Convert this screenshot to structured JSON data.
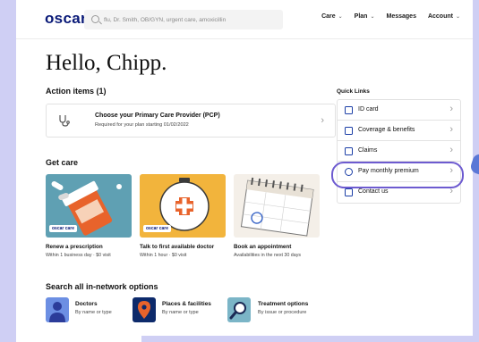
{
  "header": {
    "logo": "oscar",
    "search_placeholder": "flu, Dr. Smith, OB/GYN, urgent care, amoxicillin",
    "nav": [
      {
        "label": "Care",
        "has_menu": true
      },
      {
        "label": "Plan",
        "has_menu": true
      },
      {
        "label": "Messages",
        "has_menu": false
      },
      {
        "label": "Account",
        "has_menu": true
      }
    ],
    "caret": "⌄"
  },
  "greeting": "Hello, Chipp.",
  "action_items": {
    "title": "Action items (1)",
    "items": [
      {
        "title": "Choose your Primary Care Provider (PCP)",
        "subtitle": "Required for your plan starting 01/02/2022"
      }
    ]
  },
  "get_care": {
    "title": "Get care",
    "badge": "oscar care",
    "tiles": [
      {
        "title": "Renew a prescription",
        "subtitle": "Within 1 business day · $0 visit",
        "bg": "#5fa0b3"
      },
      {
        "title": "Talk to first available doctor",
        "subtitle": "Within 1 hour · $0 visit",
        "bg": "#f2b43c"
      },
      {
        "title": "Book an appointment",
        "subtitle": "Availabilities in the next 30 days",
        "bg": "#f4efe8"
      }
    ]
  },
  "search_all": {
    "title": "Search all in-network options",
    "options": [
      {
        "title": "Doctors",
        "subtitle": "By name or type",
        "bg": "#6c8fe3"
      },
      {
        "title": "Places & facilities",
        "subtitle": "By name or type",
        "bg": "#0d2a6b"
      },
      {
        "title": "Treatment options",
        "subtitle": "By issue or procedure",
        "bg": "#7bb5c7"
      }
    ]
  },
  "quick_links": {
    "title": "Quick Links",
    "items": [
      {
        "label": "ID card",
        "icon": "id-card-icon"
      },
      {
        "label": "Coverage & benefits",
        "icon": "shield-icon"
      },
      {
        "label": "Claims",
        "icon": "document-icon"
      },
      {
        "label": "Pay monthly premium",
        "icon": "dollar-icon"
      },
      {
        "label": "Contact us",
        "icon": "chat-icon"
      }
    ],
    "highlighted": "Pay monthly premium"
  },
  "colors": {
    "brand": "#0a1a78",
    "accent": "#1b3ea6",
    "highlight": "#6d5bd0",
    "backdrop": "#cfcff4"
  }
}
